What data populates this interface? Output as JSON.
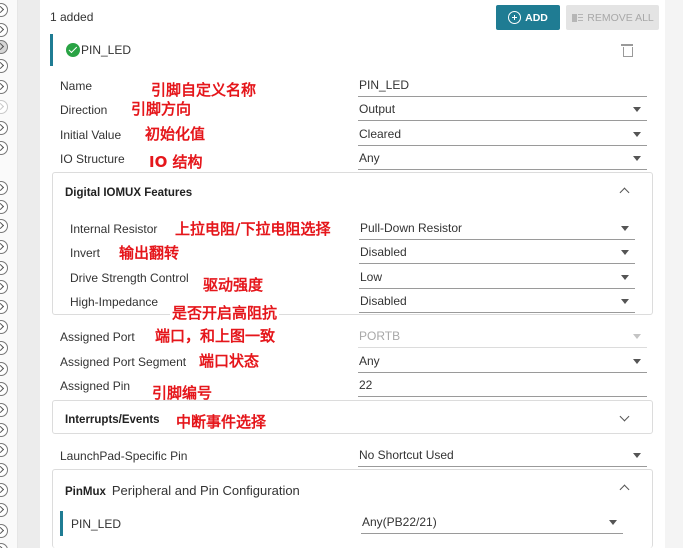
{
  "top_bar": {
    "added_count": "1 added",
    "add_button": "ADD",
    "remove_all_button": "REMOVE ALL"
  },
  "instance": {
    "name": "PIN_LED"
  },
  "fields": {
    "name": {
      "label": "Name",
      "annotation": "引脚自定义名称",
      "value": "PIN_LED"
    },
    "direction": {
      "label": "Direction",
      "annotation": "引脚方向",
      "value": "Output"
    },
    "initial_value": {
      "label": "Initial Value",
      "annotation": "初始化值",
      "value": "Cleared"
    },
    "io_structure": {
      "label": "IO Structure",
      "annotation": "IO  结构",
      "value": "Any"
    }
  },
  "iomux_group": {
    "title": "Digital IOMUX Features",
    "internal_resistor": {
      "label": "Internal Resistor",
      "annotation": "上拉电阻/下拉电阻选择",
      "value": "Pull-Down Resistor"
    },
    "invert": {
      "label": "Invert",
      "annotation": "输出翻转",
      "value": "Disabled"
    },
    "drive_strength": {
      "label": "Drive Strength Control",
      "annotation": "驱动强度",
      "value": "Low"
    },
    "high_impedance": {
      "label": "High-Impedance",
      "annotation": "是否开启高阻抗",
      "value": "Disabled"
    }
  },
  "assigned": {
    "port": {
      "label": "Assigned Port",
      "annotation": "端口，和上图一致",
      "value": "PORTB"
    },
    "port_segment": {
      "label": "Assigned Port Segment",
      "annotation": "端口状态",
      "value": "Any"
    },
    "pin": {
      "label": "Assigned Pin",
      "annotation": "引脚编号",
      "value": "22"
    }
  },
  "interrupts_group": {
    "title": "Interrupts/Events",
    "annotation": "中断事件选择"
  },
  "launchpad_pin": {
    "label": "LaunchPad-Specific Pin",
    "value": "No Shortcut Used"
  },
  "pinmux_group": {
    "title": "PinMux",
    "subtitle": "Peripheral and Pin Configuration",
    "row_label": "PIN_LED",
    "row_value": "Any(PB22/21)"
  },
  "colors": {
    "accent": "#1f7c93",
    "annotation": "#e5161b",
    "success": "#29a344"
  }
}
